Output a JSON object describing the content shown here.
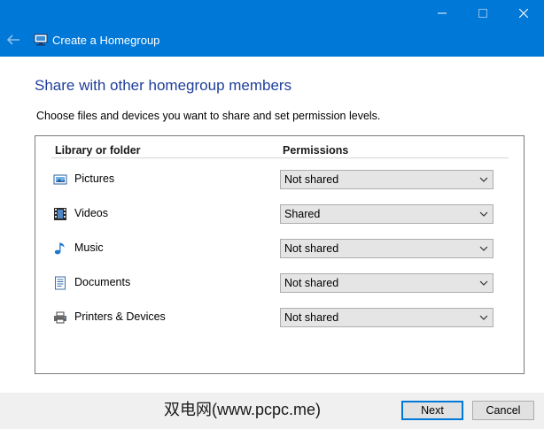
{
  "window": {
    "title": "Create a Homegroup",
    "accent_color": "#0078d7"
  },
  "page": {
    "heading": "Share with other homegroup members",
    "instruction": "Choose files and devices you want to share and set permission levels."
  },
  "table": {
    "headers": {
      "library": "Library or folder",
      "permissions": "Permissions"
    },
    "rows": [
      {
        "label": "Pictures",
        "icon": "pictures-icon",
        "permission": "Not shared"
      },
      {
        "label": "Videos",
        "icon": "videos-icon",
        "permission": "Shared"
      },
      {
        "label": "Music",
        "icon": "music-icon",
        "permission": "Not shared"
      },
      {
        "label": "Documents",
        "icon": "documents-icon",
        "permission": "Not shared"
      },
      {
        "label": "Printers & Devices",
        "icon": "printer-icon",
        "permission": "Not shared"
      }
    ]
  },
  "footer": {
    "watermark": "双电网(www.pcpc.me)",
    "next_label": "Next",
    "cancel_label": "Cancel"
  }
}
